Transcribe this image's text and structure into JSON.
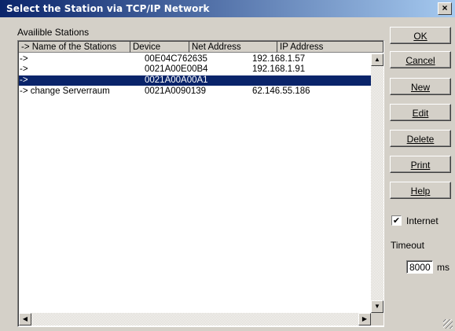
{
  "window": {
    "title": "Select the Station via TCP/IP Network",
    "close_glyph": "×"
  },
  "list": {
    "group_label": "Availible Stations",
    "columns": [
      "-> Name of the Stations",
      "Device",
      "Net Address",
      "IP Address"
    ],
    "rows": [
      {
        "name": "->",
        "device": "00E04C762635",
        "net": "",
        "ip": "192.168.1.57",
        "selected": false
      },
      {
        "name": "->",
        "device": "0021A00E00B4",
        "net": "",
        "ip": "192.168.1.91",
        "selected": false
      },
      {
        "name": "->",
        "device": "0021A00A00A1",
        "net": "",
        "ip": "",
        "selected": true
      },
      {
        "name": "-> change Serverraum",
        "device": "0021A0090139",
        "net": "",
        "ip": "62.146.55.186",
        "selected": false
      }
    ]
  },
  "buttons": {
    "ok": "OK",
    "cancel": "Cancel",
    "new": "New",
    "edit": "Edit",
    "delete": "Delete",
    "print": "Print",
    "help": "Help"
  },
  "internet": {
    "label": "Internet",
    "checked": true,
    "check_glyph": "✔"
  },
  "timeout": {
    "label": "Timeout",
    "value": "8000",
    "unit": "ms"
  },
  "scroll": {
    "up": "▲",
    "down": "▼",
    "left": "◀",
    "right": "▶"
  },
  "icons": [
    "close-icon",
    "scroll-up-arrow-icon",
    "scroll-down-arrow-icon",
    "scroll-left-arrow-icon",
    "scroll-right-arrow-icon",
    "checkmark-icon",
    "resize-grip-icon"
  ],
  "colors": {
    "title_start": "#0a246a",
    "title_end": "#a6caf0",
    "selection": "#0a246a",
    "face": "#d4d0c8"
  }
}
